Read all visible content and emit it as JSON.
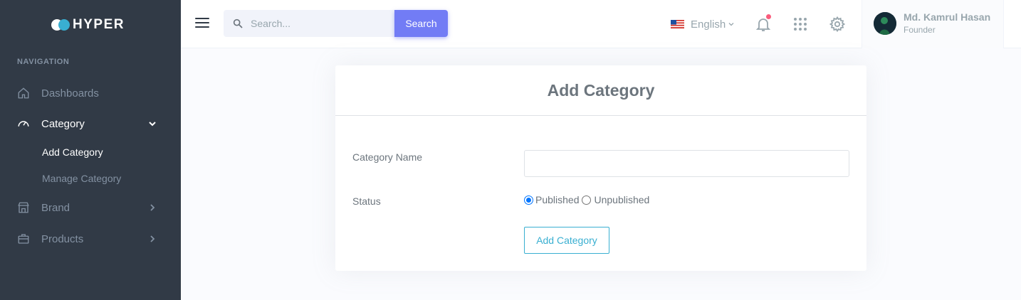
{
  "brand": {
    "name": "HYPER"
  },
  "sidebar": {
    "section_title": "NAVIGATION",
    "items": [
      {
        "label": "Dashboards",
        "icon": "home-icon"
      },
      {
        "label": "Category",
        "icon": "gauge-icon",
        "expanded": true,
        "children": [
          {
            "label": "Add Category",
            "active": true
          },
          {
            "label": "Manage Category"
          }
        ]
      },
      {
        "label": "Brand",
        "icon": "store-icon"
      },
      {
        "label": "Products",
        "icon": "briefcase-icon"
      }
    ]
  },
  "topbar": {
    "search_placeholder": "Search...",
    "search_value": "",
    "search_button": "Search",
    "language": "English",
    "icons": [
      "menu-icon",
      "search-icon",
      "us-flag-icon",
      "bell-icon",
      "apps-grid-icon",
      "gear-icon"
    ]
  },
  "user": {
    "name": "Md. Kamrul Hasan",
    "role": "Founder"
  },
  "form": {
    "title": "Add Category",
    "name_label": "Category Name",
    "name_value": "",
    "status_label": "Status",
    "status_options": [
      "Published",
      "Unpublished"
    ],
    "status_selected": "Published",
    "submit_label": "Add Category"
  },
  "colors": {
    "sidebar_bg": "#313a46",
    "primary": "#727cf5",
    "info": "#39afd1",
    "danger": "#fa5c7c",
    "page_bg": "#fafbfe"
  }
}
